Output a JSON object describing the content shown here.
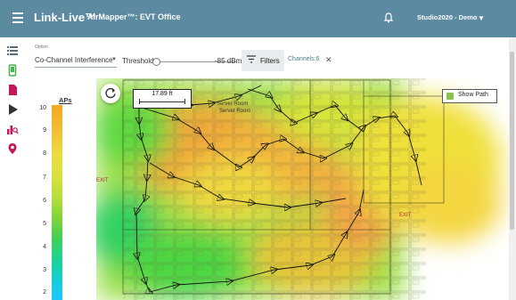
{
  "header": {
    "app_title": "Link-Live™",
    "page_title": "AirMapper™: EVT Office",
    "account": "Studio2020 - Demo",
    "menu_icon": "hamburger-icon",
    "bell_icon": "bell-icon",
    "caret_icon": "chevron-down-icon",
    "bar_color": "#5c8aa0"
  },
  "sidebar": {
    "items": [
      {
        "icon": "list-icon",
        "color": "#546e7a"
      },
      {
        "icon": "phone-icon",
        "color": "#4caf50"
      },
      {
        "icon": "document-icon",
        "color": "#c2185b"
      },
      {
        "icon": "play-icon",
        "color": "#333333"
      },
      {
        "icon": "analytics-icon",
        "color": "#c2185b"
      },
      {
        "icon": "location-pin-icon",
        "color": "#c2185b"
      }
    ]
  },
  "filters": {
    "option_label": "Option",
    "option_value": "Co-Channel Interference",
    "threshold_label": "Threshold",
    "threshold_value": "-85 dBm",
    "filters_button": "Filters",
    "channel_chip": "Channels:6"
  },
  "legend": {
    "title": "APs",
    "ticks": [
      "10",
      "9",
      "8",
      "7",
      "6",
      "5",
      "4",
      "3",
      "2"
    ]
  },
  "map": {
    "measurement": "17.89 ft",
    "show_path_label": "Show Path",
    "show_path_checked": true,
    "room_labels": [
      "Server Room",
      "Server Room",
      "EXIT",
      "EXIT"
    ]
  }
}
